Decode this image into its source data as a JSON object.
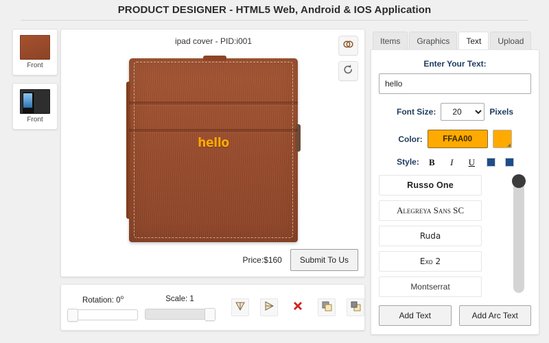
{
  "header": {
    "title": "PRODUCT DESIGNER - HTML5 Web, Android & IOS Application"
  },
  "thumbnails": [
    {
      "label": "Front",
      "view": "leather"
    },
    {
      "label": "Front",
      "view": "ipad"
    }
  ],
  "canvas": {
    "title": "ipad cover - PID:i001",
    "link_icon": "link-rings-icon",
    "reset_icon": "reset-arrow-icon",
    "artwork_text": "hello",
    "artwork_color": "#FFAA00",
    "price_label": "Price:$160",
    "submit_label": "Submit To Us"
  },
  "toolbar": {
    "rotation_label": "Rotation: 0",
    "rotation_degree_symbol": "o",
    "rotation_value": 0,
    "scale_label": "Scale: 1",
    "scale_value": 1,
    "buttons": [
      {
        "name": "flip-vertical-button",
        "icon": "flip-vertical-icon"
      },
      {
        "name": "flip-horizontal-button",
        "icon": "flip-horizontal-icon"
      },
      {
        "name": "delete-button",
        "icon": "red-cross-icon"
      },
      {
        "name": "bring-to-front-button",
        "icon": "bring-to-front-icon"
      },
      {
        "name": "send-to-back-button",
        "icon": "send-to-back-icon"
      }
    ]
  },
  "right_panel": {
    "tabs": [
      {
        "label": "Items",
        "active": false
      },
      {
        "label": "Graphics",
        "active": false
      },
      {
        "label": "Text",
        "active": true
      },
      {
        "label": "Upload",
        "active": false
      }
    ],
    "text_label": "Enter Your Text:",
    "text_value": "hello",
    "text_placeholder": "Enter Your Text",
    "font_size_label": "Font Size:",
    "font_size_value": "20",
    "font_size_options": [
      "20"
    ],
    "pixels_label": "Pixels",
    "color_label": "Color:",
    "color_value": "FFAA00",
    "color_hex": "#FFAA00",
    "style_label": "Style:",
    "style_buttons": [
      {
        "name": "bold-button",
        "glyph": "B"
      },
      {
        "name": "italic-button",
        "glyph": "I"
      },
      {
        "name": "underline-button",
        "glyph": "U"
      }
    ],
    "align_buttons": [
      {
        "name": "align-left-button"
      },
      {
        "name": "align-center-button"
      }
    ],
    "fonts": [
      {
        "label": "Russo One"
      },
      {
        "label": "Alegreya Sans SC"
      },
      {
        "label": "Ruda"
      },
      {
        "label": "Exo 2"
      },
      {
        "label": "Montserrat"
      }
    ],
    "add_text_label": "Add Text",
    "add_arc_text_label": "Add Arc Text"
  }
}
